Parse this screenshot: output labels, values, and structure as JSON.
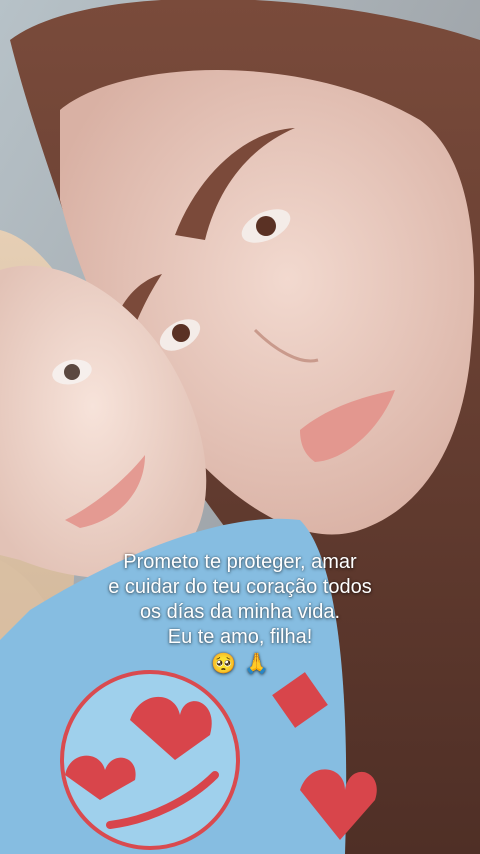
{
  "caption": {
    "lines": [
      "Prometo te proteger, amar",
      "e cuidar do teu coração todos",
      "os días da minha vida.",
      "Eu te amo, filha!"
    ],
    "emojis": [
      "🥺",
      "🙏"
    ]
  },
  "photo": {
    "subjects": [
      "adult-woman-face",
      "child-face"
    ],
    "colors": {
      "hair": "#6b4234",
      "skin_adult": "#e8c8bc",
      "skin_child": "#efd6cc",
      "shirt": "#7fb7dc",
      "heart_print": "#d8454b",
      "background": "#b9c7cf"
    }
  }
}
